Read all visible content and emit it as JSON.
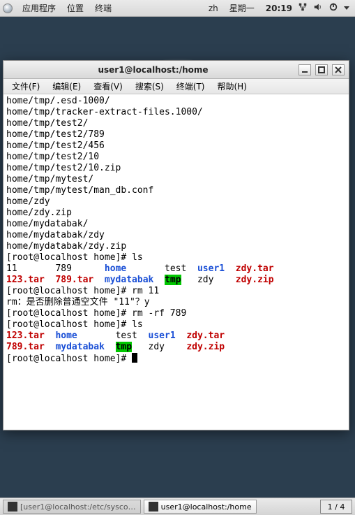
{
  "top_panel": {
    "apps": "应用程序",
    "places": "位置",
    "terminal": "终端",
    "input_method": "zh",
    "weekday": "星期一",
    "time": "20:19"
  },
  "window": {
    "title": "user1@localhost:/home"
  },
  "menubar": {
    "file": "文件(F)",
    "edit": "编辑(E)",
    "view": "查看(V)",
    "search": "搜索(S)",
    "terminal": "终端(T)",
    "help": "帮助(H)"
  },
  "term": {
    "lines": [
      "home/tmp/.esd-1000/",
      "home/tmp/tracker-extract-files.1000/",
      "home/tmp/test2/",
      "home/tmp/test2/789",
      "home/tmp/test2/456",
      "home/tmp/test2/10",
      "home/tmp/test2/10.zip",
      "home/tmp/mytest/",
      "home/tmp/mytest/man_db.conf",
      "home/zdy",
      "home/zdy.zip",
      "home/mydatabak/",
      "home/mydatabak/zdy",
      "home/mydatabak/zdy.zip"
    ],
    "prompt1": "[root@localhost home]# ls",
    "ls1": {
      "c11": "11",
      "c12": "789",
      "c13": "home",
      "c14": "test",
      "c15": "user1",
      "c16": "zdy.tar",
      "c21": "123.tar",
      "c22": "789.tar",
      "c23": "mydatabak",
      "c24": "tmp",
      "c25": "zdy",
      "c26": "zdy.zip"
    },
    "prompt_rm11": "[root@localhost home]# rm 11",
    "rm_confirm": "rm：是否删除普通空文件 \"11\"？y",
    "prompt_rmrf": "[root@localhost home]# rm -rf 789",
    "prompt2": "[root@localhost home]# ls",
    "ls2": {
      "c11": "123.tar",
      "c12": "home",
      "c13": "test",
      "c14": "user1",
      "c15": "zdy.tar",
      "c21": "789.tar",
      "c22": "mydatabak",
      "c23": "tmp",
      "c24": "zdy",
      "c25": "zdy.zip"
    },
    "prompt_final": "[root@localhost home]# "
  },
  "taskbar": {
    "task1": "[user1@localhost:/etc/sysco…",
    "task2": "user1@localhost:/home",
    "workspace": "1 / 4"
  }
}
